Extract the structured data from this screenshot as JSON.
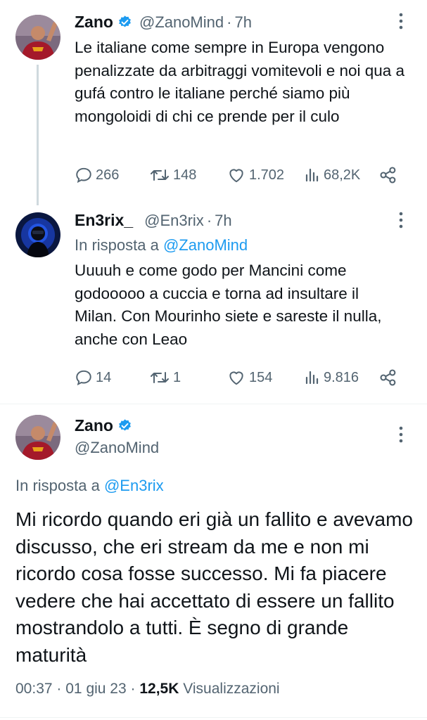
{
  "tweets": [
    {
      "name": "Zano",
      "handle": "@ZanoMind",
      "time": "7h",
      "text": "Le italiane come sempre in Europa vengono penalizzate da arbitraggi vomitevoli e noi qua a gufá contro le italiane perché siamo più mongoloidi di chi ce prende per il culo",
      "replies": "266",
      "retweets": "148",
      "likes": "1.702",
      "views": "68,2K"
    },
    {
      "name": "En3rix_",
      "handle": "@En3rix",
      "time": "7h",
      "reply_prefix": "In risposta a",
      "reply_to": "@ZanoMind",
      "text": "Uuuuh e come godo per Mancini come godooooo a cuccia e torna ad insultare il Milan. Con Mourinho siete e sareste il nulla, anche con Leao",
      "replies": "14",
      "retweets": "1",
      "likes": "154",
      "views": "9.816"
    }
  ],
  "main_tweet": {
    "name": "Zano",
    "handle": "@ZanoMind",
    "reply_prefix": "In risposta a",
    "reply_to": "@En3rix",
    "text": "Mi ricordo quando eri già un fallito e avevamo discusso, che eri stream da me e non mi ricordo cosa fosse successo. Mi fa piacere vedere che hai accettato di essere un fallito mostrandolo a tutti. È segno di grande maturità",
    "time": "00:37",
    "date": "01 giu 23",
    "views_count": "12,5K",
    "views_label": "Visualizzazioni"
  },
  "separator": "·",
  "colors": {
    "accent": "#1d9bf0",
    "secondary_text": "#536471",
    "primary_text": "#0f1419"
  }
}
